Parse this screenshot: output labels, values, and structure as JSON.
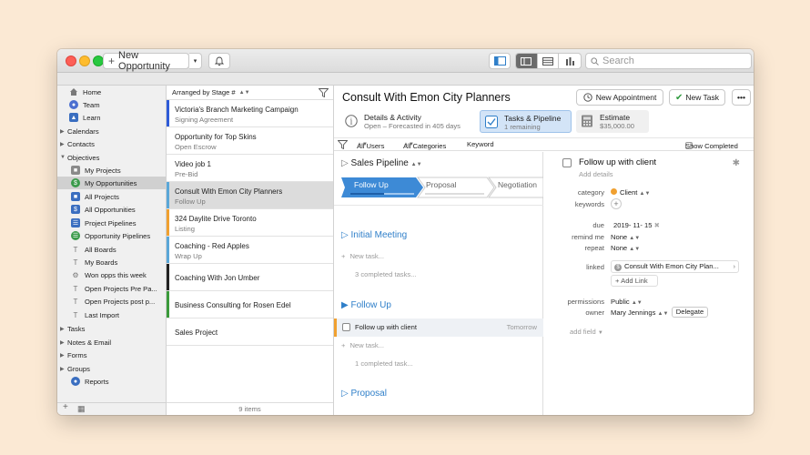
{
  "titlebar": {
    "new_opportunity_label": "New Opportunity",
    "search_placeholder": "Search"
  },
  "sidebar": {
    "home": "Home",
    "team": "Team",
    "learn": "Learn",
    "calendars": "Calendars",
    "contacts": "Contacts",
    "objectives": "Objectives",
    "my_projects": "My Projects",
    "my_opportunities": "My Opportunities",
    "all_projects": "All Projects",
    "all_opportunities": "All Opportunities",
    "project_pipelines": "Project Pipelines",
    "opportunity_pipelines": "Opportunity Pipelines",
    "all_boards": "All Boards",
    "my_boards": "My Boards",
    "won_opps": "Won opps this week",
    "open_projects_pre": "Open Projects Pre Pa...",
    "open_projects_post": "Open Projects post p...",
    "last_import": "Last Import",
    "tasks": "Tasks",
    "notes_email": "Notes & Email",
    "forms": "Forms",
    "groups": "Groups",
    "reports": "Reports"
  },
  "list": {
    "arranged_by": "Arranged by Stage #",
    "footer": "9 items",
    "rows": [
      {
        "title": "Victoria's Branch Marketing Campaign",
        "subtitle": "Signing Agreement",
        "color": "#2e5bd8"
      },
      {
        "title": "Opportunity for Top Skins",
        "subtitle": "Open Escrow",
        "color": "#ffffff"
      },
      {
        "title": "Video job 1",
        "subtitle": "Pre-Bid",
        "color": "#ffffff"
      },
      {
        "title": "Consult With Emon City Planners",
        "subtitle": "Follow Up",
        "color": "#5aa7d8"
      },
      {
        "title": "324 Daylite Drive Toronto",
        "subtitle": "Listing",
        "color": "#f0a030"
      },
      {
        "title": "Coaching - Red Apples",
        "subtitle": "Wrap Up",
        "color": "#5aa7d8"
      },
      {
        "title": "Coaching With Jon Umber",
        "subtitle": "",
        "color": "#222222"
      },
      {
        "title": "Business Consulting for Rosen Edel",
        "subtitle": "",
        "color": "#3a9a3a"
      },
      {
        "title": "Sales Project",
        "subtitle": "",
        "color": "#ffffff"
      }
    ]
  },
  "main": {
    "title": "Consult With Emon City Planners",
    "new_appointment": "New Appointment",
    "new_task": "New Task",
    "tabs": {
      "details": {
        "title": "Details & Activity",
        "sub": "Open – Forecasted in 405 days"
      },
      "tasks": {
        "title": "Tasks & Pipeline",
        "sub": "1 remaining"
      },
      "estimate": {
        "title": "Estimate",
        "sub": "$35,000.00"
      }
    },
    "filter": {
      "users": "All Users",
      "categories": "All Categories",
      "keyword": "Keyword",
      "show_completed": "Show Completed"
    },
    "pipeline": {
      "name": "Sales Pipeline",
      "stages": [
        "Follow Up",
        "Proposal",
        "Negotiation"
      ],
      "sections": [
        {
          "title": "Initial Meeting",
          "new_task": "New task...",
          "completed": "3 completed tasks..."
        },
        {
          "title": "Follow Up",
          "task": "Follow up with client",
          "due": "Tomorrow",
          "new_task": "New task...",
          "completed": "1 completed task..."
        },
        {
          "title": "Proposal"
        }
      ]
    },
    "detail": {
      "title": "Follow up with client",
      "add_details": "Add details",
      "category_label": "category",
      "category_value": "Client",
      "keywords_label": "keywords",
      "due_label": "due",
      "due_value": "2019- 11- 15",
      "remind_label": "remind me",
      "remind_value": "None",
      "repeat_label": "repeat",
      "repeat_value": "None",
      "linked_label": "linked",
      "linked_value": "Consult With Emon City Plan...",
      "add_link": "Add Link",
      "permissions_label": "permissions",
      "permissions_value": "Public",
      "owner_label": "owner",
      "owner_value": "Mary Jennings",
      "delegate": "Delegate",
      "add_field": "add field"
    }
  },
  "colors": {
    "accent": "#2f7fc9",
    "category_dot": "#f0a030"
  }
}
